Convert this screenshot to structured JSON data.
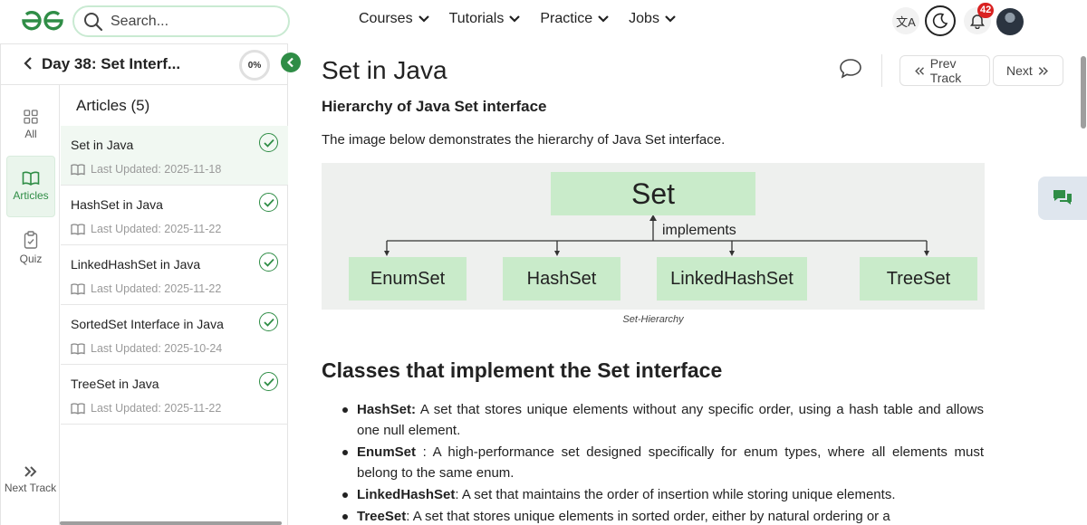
{
  "header": {
    "search_placeholder": "Search...",
    "nav": [
      "Courses",
      "Tutorials",
      "Practice",
      "Jobs"
    ],
    "translate_glyph": "文A",
    "notification_count": "42"
  },
  "sidebar": {
    "day_title": "Day 38: Set Interf...",
    "progress": "0%",
    "rail": [
      {
        "label": "All",
        "icon": "grid-icon"
      },
      {
        "label": "Articles",
        "icon": "book-icon"
      },
      {
        "label": "Quiz",
        "icon": "clipboard-icon"
      }
    ],
    "next_track": "Next Track",
    "articles_title": "Articles (5)",
    "articles": [
      {
        "name": "Set in Java",
        "date": "Last Updated: 2025-11-18",
        "done": true
      },
      {
        "name": "HashSet in Java",
        "date": "Last Updated: 2025-11-22",
        "done": true
      },
      {
        "name": "LinkedHashSet in Java",
        "date": "Last Updated: 2025-11-22",
        "done": true
      },
      {
        "name": "SortedSet Interface in Java",
        "date": "Last Updated: 2025-10-24",
        "done": true
      },
      {
        "name": "TreeSet in Java",
        "date": "Last Updated: 2025-11-22",
        "done": true
      }
    ]
  },
  "main": {
    "title": "Set in Java",
    "prev_label": "Prev Track",
    "next_label": "Next",
    "section_heading": "Hierarchy of Java Set interface",
    "intro": "The image below demonstrates the hierarchy of Java Set interface.",
    "diagram": {
      "root": "Set",
      "relation": "implements",
      "children": [
        "EnumSet",
        "HashSet",
        "LinkedHashSet",
        "TreeSet"
      ]
    },
    "caption": "Set-Hierarchy",
    "classes_heading": "Classes that implement the Set interface",
    "bullets": [
      {
        "term": "HashSet:",
        "text": " A set that stores unique elements without any specific order, using a hash table and allows one null element."
      },
      {
        "term": "EnumSet",
        "text": " : A high-performance set designed specifically for enum types, where all elements must belong to the same enum."
      },
      {
        "term": "LinkedHashSet",
        "text": ": A set that maintains the order of insertion while storing unique elements."
      },
      {
        "term": "TreeSet",
        "text": ": A set that stores unique elements in sorted order, either by natural ordering or a"
      }
    ]
  },
  "colors": {
    "brand_green": "#2f8d46",
    "box_green": "#c9ebca",
    "badge_red": "#d92121"
  }
}
